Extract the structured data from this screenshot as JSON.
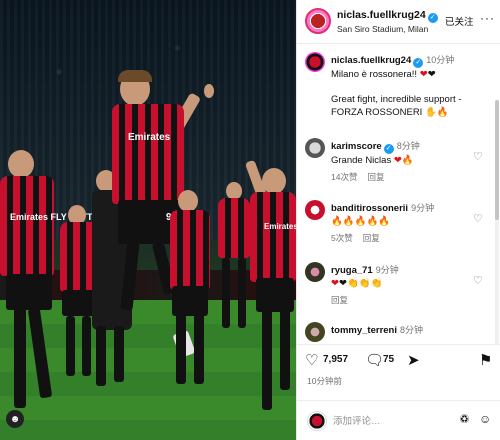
{
  "post": {
    "header": {
      "username": "niclas.fuellkrug24",
      "location": "San Siro Stadium, Milan",
      "follow_label": "已关注",
      "more_label": "···"
    },
    "caption": {
      "username": "niclas.fuellkrug24",
      "time": "10分钟",
      "line1": "Milano è rossonera!!",
      "line1_emoji": "❤️🖤",
      "line2": "Great fight, incredible support - FORZA ROSSONERI",
      "line2_emoji": "💪🔥"
    },
    "comments": [
      {
        "username": "karimscore",
        "time": "8分钟",
        "text": "Grande Niclas",
        "emoji": "❤️🔥",
        "likes": "14次赞",
        "reply": "回复"
      },
      {
        "username": "banditirossonerii",
        "time": "9分钟",
        "text": "",
        "emoji": "🔥🔥🔥🔥🔥",
        "likes": "5次赞",
        "reply": "回复"
      },
      {
        "username": "ryuga_71",
        "time": "9分钟",
        "text": "",
        "emoji": "❤️🖤👏👏👏",
        "likes": "",
        "reply": "回复"
      },
      {
        "username": "tommy_terreni",
        "time": "8分钟",
        "text": "",
        "emoji": "",
        "likes": "",
        "reply": ""
      }
    ],
    "actions": {
      "like_count": "7,957",
      "comment_count": "75",
      "time_ago": "10分钟前"
    },
    "add_comment": {
      "placeholder": "添加评论…"
    },
    "photo": {
      "sponsor_main": "Emirates FLY BETTER",
      "number": "9"
    }
  }
}
